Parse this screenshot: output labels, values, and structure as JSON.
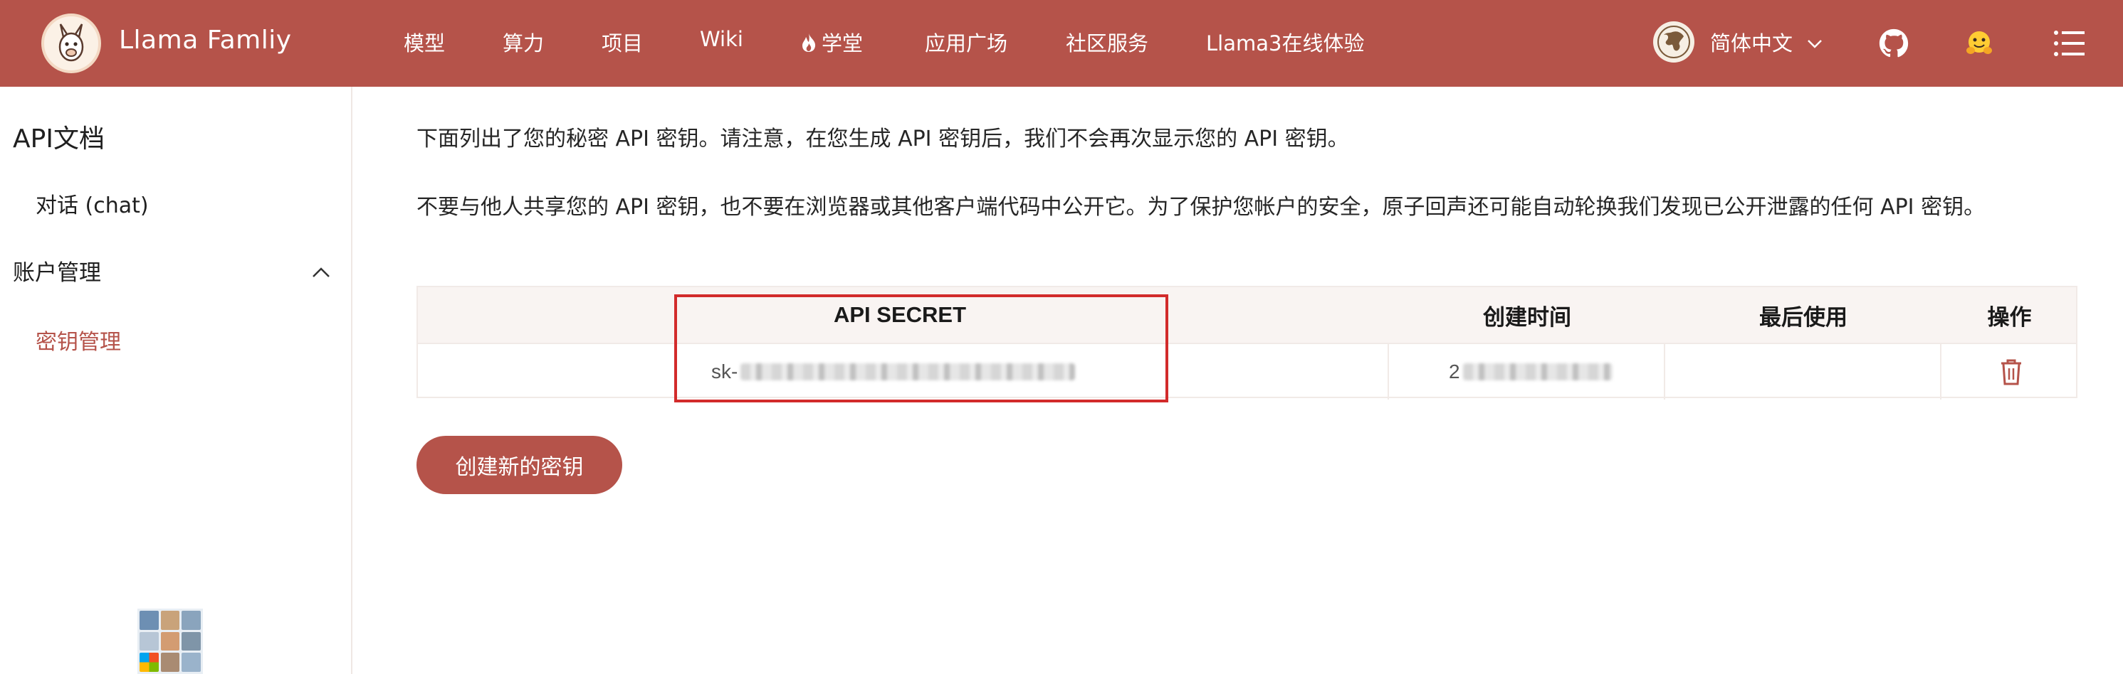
{
  "header": {
    "brand": "Llama Famliy",
    "nav": [
      "模型",
      "算力",
      "项目",
      "Wiki",
      "学堂",
      "应用广场",
      "社区服务",
      "Llama3在线体验"
    ],
    "language": "简体中文"
  },
  "sidebar": {
    "title": "API文档",
    "chat_item": "对话 (chat)",
    "group_label": "账户管理",
    "active_item": "密钥管理"
  },
  "main": {
    "intro": "下面列出了您的秘密 API 密钥。请注意，在您生成 API 密钥后，我们不会再次显示您的 API 密钥。",
    "warning": "不要与他人共享您的 API 密钥，也不要在浏览器或其他客户端代码中公开它。为了保护您帐户的安全，原子回声还可能自动轮换我们发现已公开泄露的任何 API 密钥。",
    "table": {
      "headers": [
        "API SECRET",
        "创建时间",
        "最后使用",
        "操作"
      ],
      "rows": [
        {
          "secret_prefix": "sk-",
          "created_prefix": "2"
        }
      ]
    },
    "create_button": "创建新的密钥"
  },
  "colors": {
    "brand": "#b5534a",
    "highlight_box": "#d22b2b",
    "table_header_bg": "#f9f4f2"
  },
  "icons": [
    "llama-logo-icon",
    "fire-icon",
    "globe-icon",
    "chevron-down-icon",
    "github-icon",
    "huggingface-icon",
    "menu-icon",
    "chevron-up-icon",
    "trash-icon"
  ]
}
